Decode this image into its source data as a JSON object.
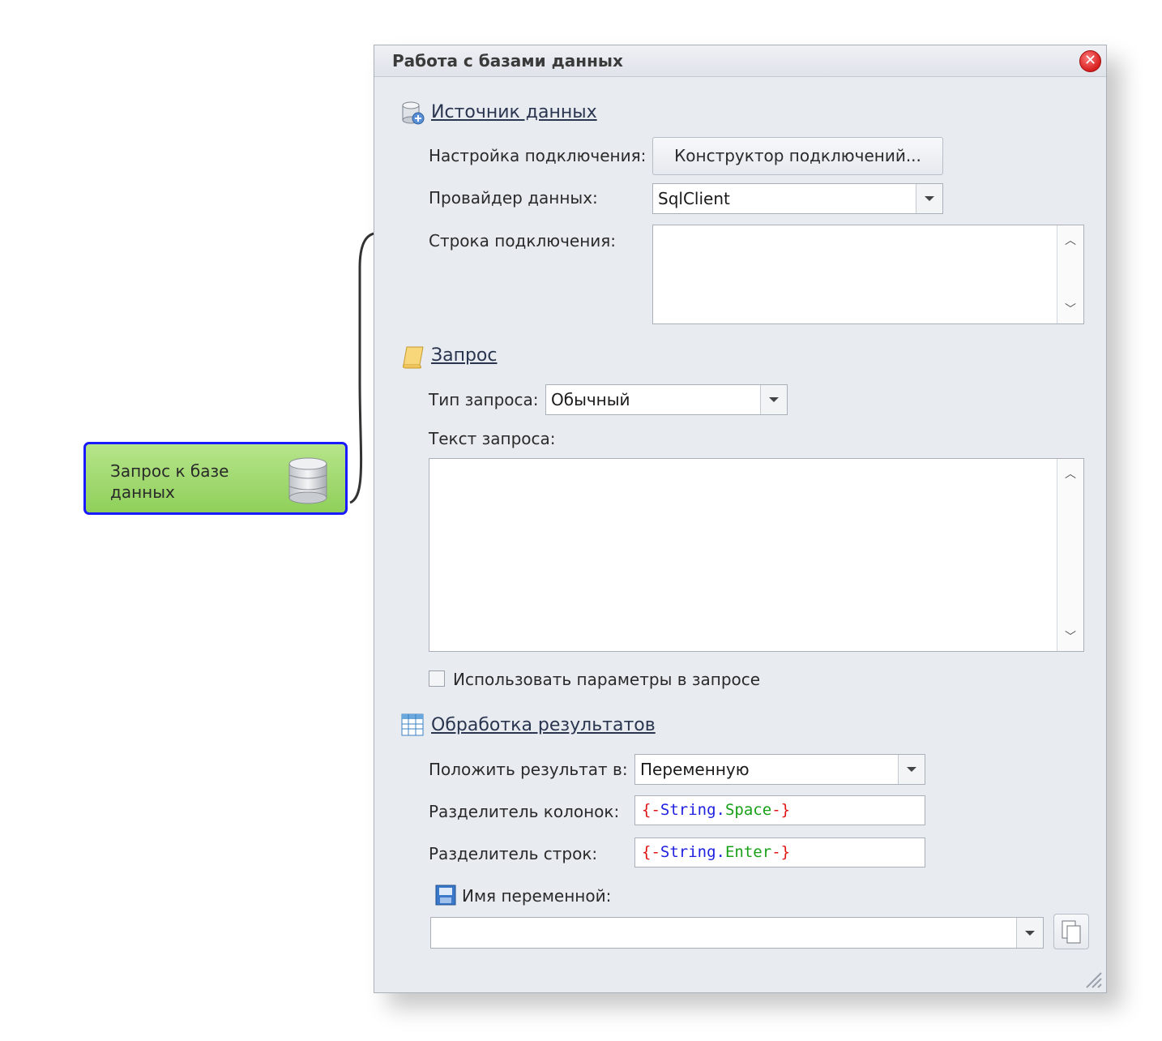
{
  "canvas": {
    "node": {
      "label": "Запрос к базе данных",
      "icon": "database-icon"
    }
  },
  "dialog": {
    "title": "Работа с базами данных",
    "close_icon": "close-icon",
    "datasource": {
      "title": "Источник данных",
      "icon": "database-settings-icon",
      "connection_setup_label": "Настройка подключения:",
      "connection_builder_button": "Конструктор подключений...",
      "provider_label": "Провайдер данных:",
      "provider_value": "SqlClient",
      "connection_string_label": "Строка подключения:",
      "connection_string_value": ""
    },
    "query": {
      "title": "Запрос",
      "icon": "scroll-icon",
      "type_label": "Тип запроса:",
      "type_value": "Обычный",
      "text_label": "Текст запроса:",
      "text_value": "",
      "use_params_label": "Использовать параметры в запросе",
      "use_params_checked": false
    },
    "results": {
      "title": "Обработка результатов",
      "icon": "table-icon",
      "put_result_label": "Положить результат в:",
      "put_result_value": "Переменную",
      "column_sep_label": "Разделитель колонок:",
      "column_sep": {
        "open": "{-",
        "kw": "String",
        "dot": ".",
        "member": "Space",
        "close": "-}"
      },
      "row_sep_label": "Разделитель строк:",
      "row_sep": {
        "open": "{-",
        "kw": "String",
        "dot": ".",
        "member": "Enter",
        "close": "-}"
      },
      "variable_name_label": "Имя переменной:",
      "variable_name_value": ""
    }
  },
  "colors": {
    "node_fill": "#9ed66a",
    "node_border": "#1a1aff",
    "close_red": "#d61e1e",
    "token_bracket": "#e01414",
    "token_keyword": "#2020e0",
    "token_member": "#18a018"
  }
}
